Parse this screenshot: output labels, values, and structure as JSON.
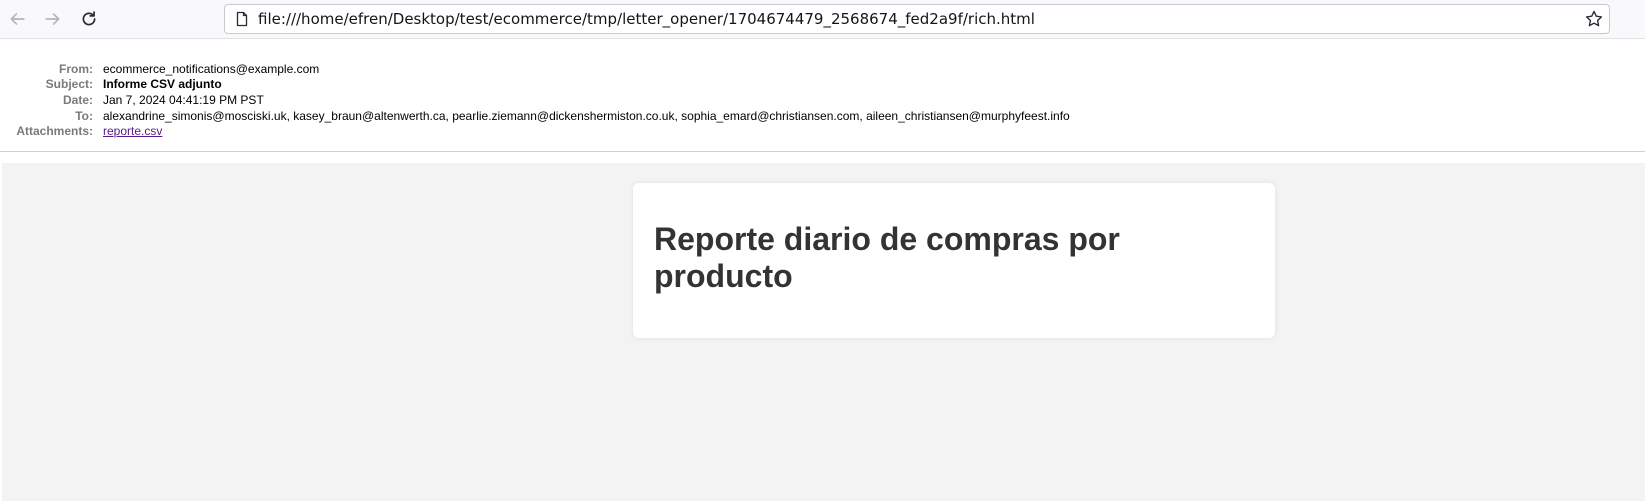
{
  "browser": {
    "back_icon": "arrow-left-icon",
    "forward_icon": "arrow-right-icon",
    "reload_icon": "reload-icon",
    "page_icon": "page-icon",
    "bookmark_icon": "star-icon",
    "url": "file:///home/efren/Desktop/test/ecommerce/tmp/letter_opener/1704674479_2568674_fed2a9f/rich.html"
  },
  "email": {
    "labels": {
      "from": "From:",
      "subject": "Subject:",
      "date": "Date:",
      "to": "To:",
      "attachments": "Attachments:"
    },
    "from": "ecommerce_notifications@example.com",
    "subject": "Informe CSV adjunto",
    "date": "Jan 7, 2024 04:41:19 PM PST",
    "to": "alexandrine_simonis@mosciski.uk, kasey_braun@altenwerth.ca, pearlie.ziemann@dickenshermiston.co.uk, sophia_emard@christiansen.com, aileen_christiansen@murphyfeest.info",
    "attachment": "reporte.csv"
  },
  "body": {
    "heading": "Reporte diario de compras por producto"
  },
  "colors": {
    "content_background": "#f3f3f3",
    "card_background": "#ffffff",
    "heading_text": "#333333",
    "link": "#551a8b"
  }
}
